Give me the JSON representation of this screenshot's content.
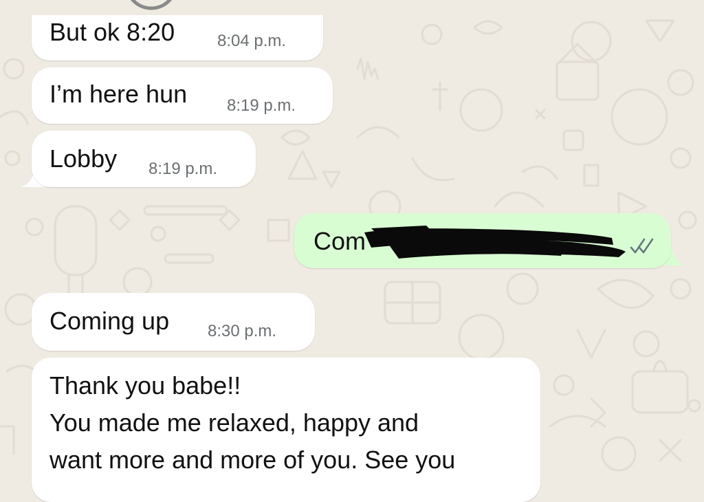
{
  "chat": {
    "messages": [
      {
        "direction": "incoming",
        "text": "But ok 8:20",
        "time": "8:04 p.m."
      },
      {
        "direction": "incoming",
        "text": "I’m here hun",
        "time": "8:19 p.m."
      },
      {
        "direction": "incoming",
        "text": "Lobby",
        "time": "8:19 p.m."
      },
      {
        "direction": "outgoing",
        "text": "Com",
        "time": "",
        "status": "read"
      },
      {
        "direction": "incoming",
        "text": "Coming up",
        "time": "8:30 p.m."
      },
      {
        "direction": "incoming",
        "lines": [
          "Thank you babe!!",
          "You made me relaxed, happy and",
          "want more and more of you. See you"
        ]
      }
    ]
  },
  "colors": {
    "wallpaper": "#efeae2",
    "incoming_bubble": "#ffffff",
    "outgoing_bubble": "#d9fdd3",
    "timestamp": "#6b6f72",
    "read_ticks": "#667781"
  },
  "icons": {
    "read_receipt": "double-check-icon"
  }
}
